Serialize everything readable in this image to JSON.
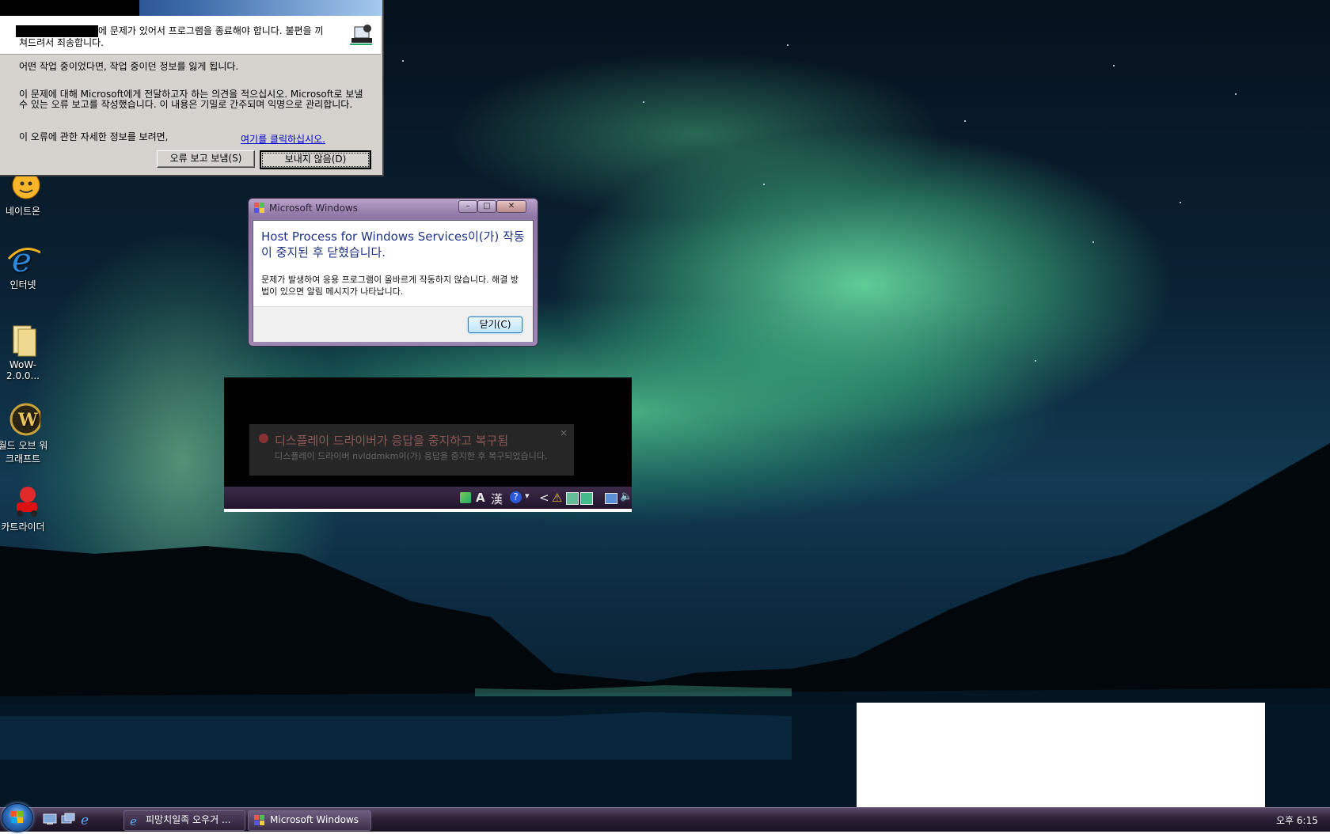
{
  "desktop": {
    "icons": [
      {
        "label": "네이트온"
      },
      {
        "label": "인터넷"
      },
      {
        "label": "WoW-2.0.0..."
      },
      {
        "label": "월드 오브 워크래프트"
      },
      {
        "label": "카트라이더"
      }
    ]
  },
  "error_report": {
    "header_text": "에 문제가 있어서 프로그램을 종료해야 합니다. 불편을 끼쳐드려서 죄송합니다.",
    "line1": "어떤 작업 중이었다면, 작업 중이던 정보를 잃게 됩니다.",
    "line2": "이 문제에 대해 Microsoft에게 전달하고자 하는 의견을 적으십시오. Microsoft로 보낼 수 있는 오류 보고를 작성했습니다. 이 내용은 기밀로 간주되며 익명으로 관리합니다.",
    "details_prefix": "이 오류에 관한 자세한 정보를 보려면,",
    "details_link": "여기를 클릭하십시오.",
    "send_button": "오류 보고 보냄(S)",
    "dont_send_button": "보내지 않음(D)"
  },
  "windows_dialog": {
    "title": "Microsoft Windows",
    "main_instruction": "Host Process for Windows Services이(가) 작동이 중지된 후 닫혔습니다.",
    "content": "문제가 발생하여 응용 프로그램이 올바르게 작동하지 않습니다. 해결 방법이 있으면 알림 메시지가 나타납니다.",
    "close_button": "닫기(C)"
  },
  "captured_balloon": {
    "title": "디스플레이 드라이버가 응답을 중지하고 복구됨",
    "body": "디스플레이 드라이버 nvlddmkm이(가) 응답을 중지한 후 복구되었습니다."
  },
  "captured_tray": {
    "ime_a": "A",
    "ime_hanja": "漢",
    "help": "?",
    "chevron": "<"
  },
  "taskbar": {
    "buttons": [
      {
        "label": "피망치일족 오우거 ..."
      },
      {
        "label": "Microsoft Windows"
      }
    ],
    "clock": "오후 6:15"
  },
  "colors": {
    "dialog_main_text": "#1e3287",
    "link": "#0000cc",
    "taskbar": "#2b1f35"
  }
}
